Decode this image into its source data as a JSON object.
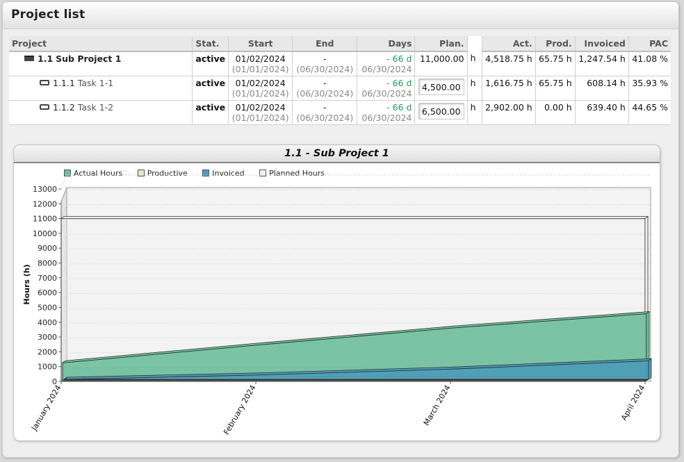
{
  "page": {
    "title": "Project list"
  },
  "table": {
    "columns": [
      "Project",
      "Stat.",
      "Start",
      "End",
      "Days",
      "Plan.",
      "",
      "Act.",
      "Prod.",
      "Invoiced",
      "PAC"
    ],
    "rows": [
      {
        "icon": "project-bar-icon",
        "id": "1.1",
        "name": "Sub Project 1",
        "status": "active",
        "start": "01/02/2024",
        "start_planned": "(01/01/2024)",
        "end": "-",
        "end_planned": "(06/30/2024)",
        "days": "- 66 d",
        "days_date": "06/30/2024",
        "plan": "11,000.00",
        "unit": "h",
        "act": "4,518.75 h",
        "prod": "65.75 h",
        "invoiced": "1,247.54 h",
        "pac": "41.08 %"
      },
      {
        "icon": "task-bar-icon",
        "id": "1.1.1",
        "name": "Task 1-1",
        "status": "active",
        "start": "01/02/2024",
        "start_planned": "(01/01/2024)",
        "end": "-",
        "end_planned": "(06/30/2024)",
        "days": "- 66 d",
        "days_date": "06/30/2024",
        "plan": "4,500.00",
        "unit": "h",
        "act": "1,616.75 h",
        "prod": "65.75 h",
        "invoiced": "608.14 h",
        "pac": "35.93 %"
      },
      {
        "icon": "task-bar-icon",
        "id": "1.1.2",
        "name": "Task 1-2",
        "status": "active",
        "start": "01/02/2024",
        "start_planned": "(01/01/2024)",
        "end": "-",
        "end_planned": "(06/30/2024)",
        "days": "- 66 d",
        "days_date": "06/30/2024",
        "plan": "6,500.00",
        "unit": "h",
        "act": "2,902.00 h",
        "prod": "0.00 h",
        "invoiced": "639.40 h",
        "pac": "44.65 %"
      }
    ]
  },
  "chart_data": {
    "type": "area",
    "title": "1.1 - Sub Project 1",
    "ylabel": "Hours (h)",
    "xlabel": "",
    "ylim": [
      0,
      13000
    ],
    "yticks": [
      0,
      1000,
      2000,
      3000,
      4000,
      5000,
      6000,
      7000,
      8000,
      9000,
      10000,
      11000,
      12000,
      13000
    ],
    "categories": [
      "January 2024",
      "February 2024",
      "March 2024",
      "April 2024"
    ],
    "series": [
      {
        "name": "Actual Hours",
        "color": "#6dbf9c",
        "values": [
          1200,
          2400,
          3550,
          4520
        ]
      },
      {
        "name": "Productive",
        "color": "#e8e8c8",
        "values": [
          20,
          40,
          60,
          66
        ]
      },
      {
        "name": "Invoiced",
        "color": "#4a9cb8",
        "values": [
          0,
          300,
          700,
          1250
        ]
      },
      {
        "name": "Planned Hours",
        "color": "#f2f2f2",
        "values": [
          11000,
          11000,
          11000,
          11000
        ]
      }
    ],
    "grid": true,
    "legend": "top-left"
  }
}
